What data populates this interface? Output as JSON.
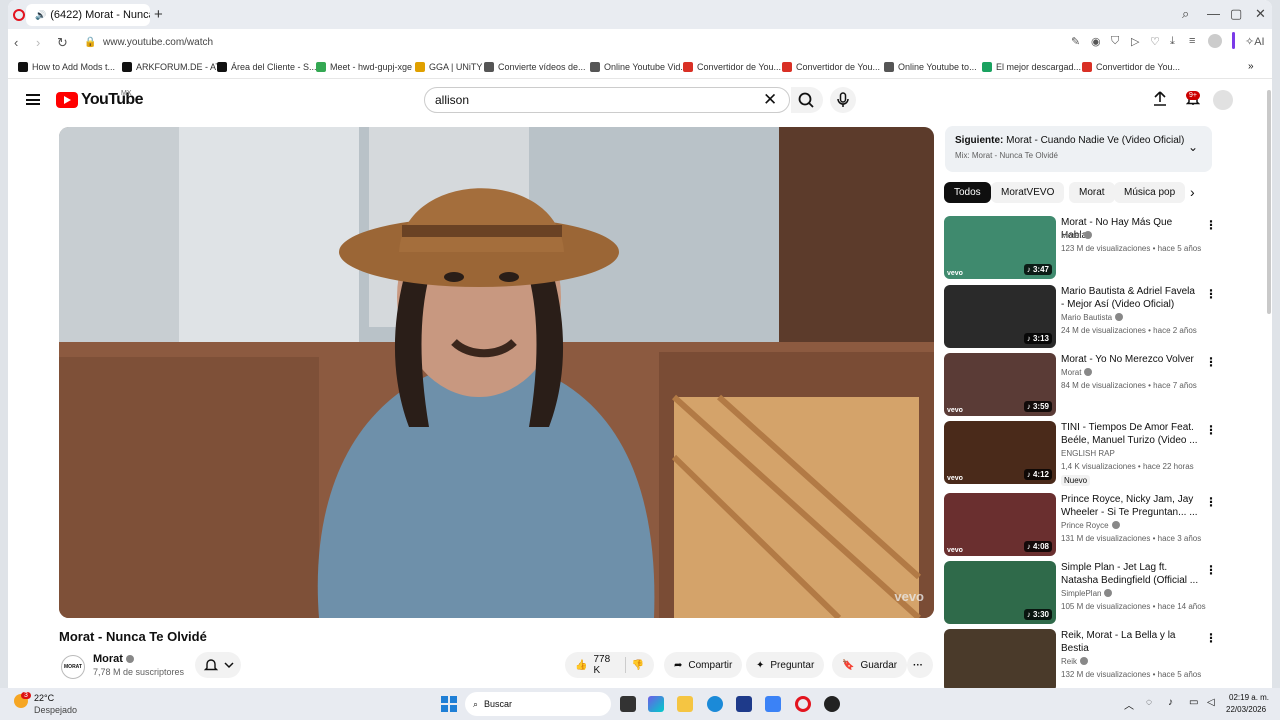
{
  "browser": {
    "tab_title": "(6422) Morat - Nunca",
    "new_tab": "+",
    "url": "www.youtube.com/watch",
    "ai_label": "AI"
  },
  "bookmarks": [
    {
      "label": "How to Add Mods t...",
      "color": "#111111"
    },
    {
      "label": "ARKFORUM.DE - AT...",
      "color": "#111111"
    },
    {
      "label": "Área del Cliente - S...",
      "color": "#111111"
    },
    {
      "label": "Meet - hwd-gupj-xge",
      "color": "#34a853"
    },
    {
      "label": "GGA | UNiTY",
      "color": "#e0a000"
    },
    {
      "label": "Convierte vídeos de...",
      "color": "#555555"
    },
    {
      "label": "Online Youtube Vid...",
      "color": "#555555"
    },
    {
      "label": "Convertidor de You...",
      "color": "#d93025"
    },
    {
      "label": "Convertidor de You...",
      "color": "#d93025"
    },
    {
      "label": "Online Youtube to...",
      "color": "#555555"
    },
    {
      "label": "El mejor descargad...",
      "color": "#1aa260"
    },
    {
      "label": "Convertidor de You...",
      "color": "#d93025"
    }
  ],
  "youtube": {
    "logo_text": "YouTube",
    "region": "MX",
    "search_value": "allison",
    "notif_badge": "9+"
  },
  "video": {
    "title": "Morat - Nunca Te Olvidé",
    "channel": "Morat",
    "channel_logo_text": "MORAT",
    "subscribers": "7,78 M de suscriptores",
    "likes": "778 K",
    "share": "Compartir",
    "ask": "Preguntar",
    "save": "Guardar",
    "watermark": "vevo"
  },
  "next_up": {
    "label": "Siguiente:",
    "title": "Morat - Cuando Nadie Ve (Video Oficial)",
    "mix": "Mix: Morat - Nunca Te Olvidé"
  },
  "chips": [
    "Todos",
    "MoratVEVO",
    "Morat",
    "Música pop"
  ],
  "recommendations": [
    {
      "title": "Morat - No Hay Más Que Hablar",
      "channel": "Morat",
      "meta": "123 M de visualizaciones • hace 5 años",
      "duration": "3:47",
      "vevo": "vevo",
      "thumb": "#3f8a6e"
    },
    {
      "title": "Mario Bautista & Adriel Favela - Mejor Así (Video Oficial)",
      "channel": "Mario Bautista",
      "meta": "24 M de visualizaciones • hace 2 años",
      "duration": "3:13",
      "vevo": "",
      "thumb": "#2a2a2a"
    },
    {
      "title": "Morat - Yo No Merezco Volver",
      "channel": "Morat",
      "meta": "84 M de visualizaciones • hace 7 años",
      "duration": "3:59",
      "vevo": "vevo",
      "thumb": "#5a3b36"
    },
    {
      "title": "TINI - Tiempos De Amor Feat. Beéle, Manuel Turizo (Video ...",
      "channel": "ENGLISH RAP",
      "meta": "1,4 K visualizaciones • hace 22 horas",
      "duration": "4:12",
      "vevo": "vevo",
      "badge": "Nuevo",
      "thumb": "#4a2a1a"
    },
    {
      "title": "Prince Royce, Nicky Jam, Jay Wheeler - Si Te Preguntan... ...",
      "channel": "Prince Royce",
      "meta": "131 M de visualizaciones • hace 3 años",
      "duration": "4:08",
      "vevo": "vevo",
      "thumb": "#6a2f2f"
    },
    {
      "title": "Simple Plan - Jet Lag ft. Natasha Bedingfield (Official ...",
      "channel": "SimplePlan",
      "meta": "105 M de visualizaciones • hace 14 años",
      "duration": "3:30",
      "vevo": "",
      "thumb": "#2f6a4a"
    },
    {
      "title": "Reik, Morat - La Bella y la Bestia",
      "channel": "Reik",
      "meta": "132 M de visualizaciones • hace 5 años",
      "duration": "",
      "vevo": "",
      "thumb": "#4a3a2a"
    }
  ],
  "taskbar": {
    "temp": "22°C",
    "weather": "Despejado",
    "weather_badge": "3",
    "search": "Buscar",
    "time": "02:19 a. m.",
    "date": "22/03/2026"
  }
}
